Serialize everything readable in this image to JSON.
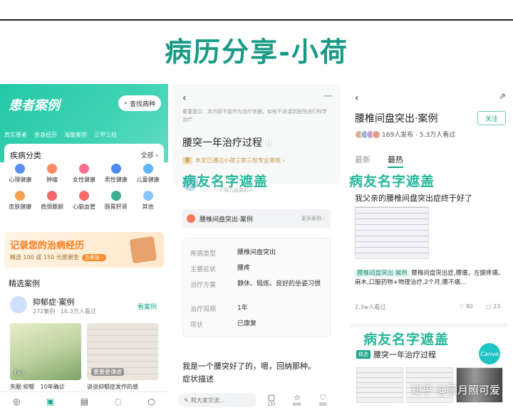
{
  "page": {
    "title": "病历分享-小荷",
    "watermark": "知乎 @圆月照可爱"
  },
  "panel1": {
    "header_title": "患者案例",
    "search_label": "查找病种",
    "tags": [
      "真实患者",
      "亲身经历",
      "海量案例",
      "三甲三校"
    ],
    "category_title": "疾病分类",
    "category_all": "全部 ›",
    "categories": [
      {
        "label": "心理健康",
        "color": "#5b8ff9"
      },
      {
        "label": "肿瘤",
        "color": "#ff8a65"
      },
      {
        "label": "女性健康",
        "color": "#ff6f91"
      },
      {
        "label": "男性健康",
        "color": "#4d8af0"
      },
      {
        "label": "儿童健康",
        "color": "#5fb3f6"
      },
      {
        "label": "皮肤健康",
        "color": "#f3a34b"
      },
      {
        "label": "肩颈腰腿",
        "color": "#f06a6a"
      },
      {
        "label": "心脑血管",
        "color": "#ff6b6b"
      },
      {
        "label": "肠胃肝肾",
        "color": "#3db18f"
      },
      {
        "label": "其他",
        "color": "#8ac4ff"
      }
    ],
    "banner_title": "记录您的治病经历",
    "banner_sub": "精选 100 或 150 元感谢金",
    "banner_btn": "去参加 ›",
    "section_title": "精选案例",
    "case_name": "抑郁症·案例",
    "case_meta": "272案例 · 16.3万人看过",
    "case_view": "看案例",
    "img1_label": "Fair",
    "img2_label": "姜姜要谦虚",
    "caption1": "失眠·抑郁　10年确诊",
    "caption2": "谈谈抑郁症发作的感",
    "nav_icons": [
      "compass-icon",
      "case-icon",
      "doc-icon",
      "chat-icon",
      "user-icon"
    ]
  },
  "panel2": {
    "back": "‹",
    "more": "···",
    "notice": "重要提示：本内容不能作为治疗依据，如有不适请到医院进行科学治疗",
    "title": "腰突一年治疗过程",
    "review_badge": "审",
    "review_text": "本文已通过小荷三审三校专业审核 ›",
    "user_sub": "一个努力自救的人",
    "mask_text": "病友名字遮盖",
    "case_link": "腰椎间盘突出·案例",
    "case_more": "更多案例 ›",
    "info": [
      {
        "k": "疾病类型",
        "v": "腰椎间盘突出"
      },
      {
        "k": "主要症状",
        "v": "腰疼"
      },
      {
        "k": "治疗方案",
        "v": "静休、锻炼、良好的坐姿习惯"
      },
      {
        "k": "治疗周期",
        "v": "1年"
      },
      {
        "k": "现状",
        "v": "已康复"
      }
    ],
    "body_line1": "我是一个腰突好了的，嗯，回纳那种。",
    "body_line2": "症状描述",
    "input_placeholder": "和大家交流...",
    "stats": [
      {
        "icon": "▢",
        "count": "133"
      },
      {
        "icon": "☆",
        "count": "600"
      },
      {
        "icon": "♡",
        "count": "300"
      }
    ]
  },
  "panel3": {
    "back": "‹",
    "title": "腰椎间盘突出·案例",
    "follow": "关注",
    "meta": "169人发布 · 5.3万人看过",
    "tab_latest": "最新",
    "tab_hot": "最热",
    "mask_text": "病友名字遮盖",
    "post_title": "我父亲的腰椎间盘突出症终于好了",
    "post_tag": "腰椎间盘突出 案例",
    "post_desc": "腰椎间盘突出症,腰痛，左腿疼痛、麻木,口服药物+物理治疗,2个月,腰不痛...",
    "views": "2.3w人看过",
    "likes": "♡ 80",
    "comments": "▢ 23",
    "card2_mask": "病友名字遮盖",
    "card2_tag": "精选",
    "card2_title": "腰突一年治疗过程",
    "canva": "Canva"
  }
}
